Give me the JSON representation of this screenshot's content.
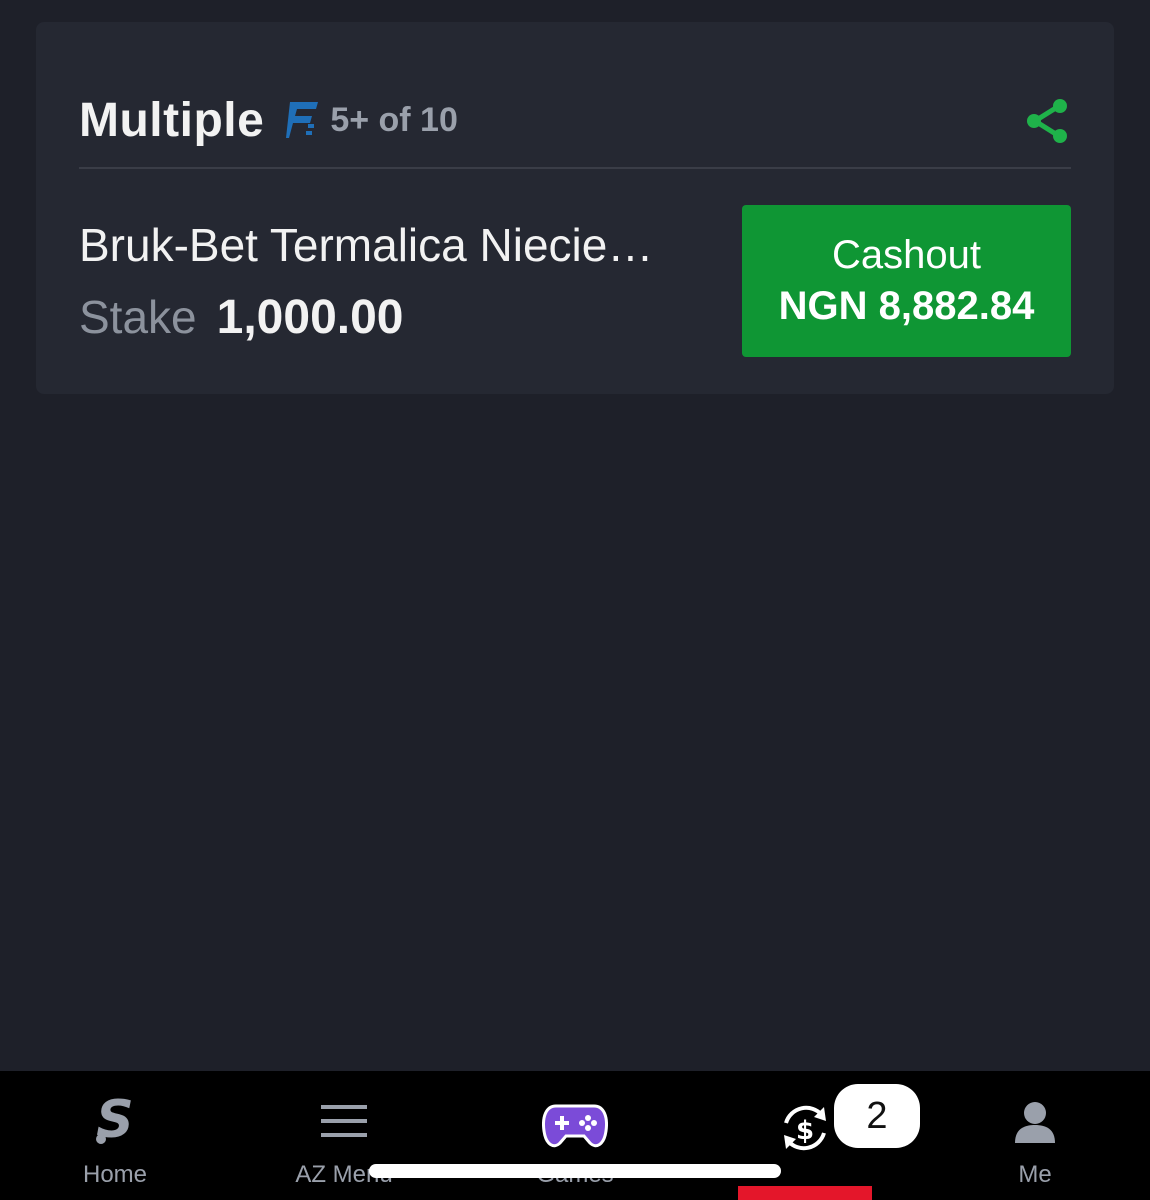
{
  "bet": {
    "type": "Multiple",
    "flex_label": "5+ of 10",
    "match": "Bruk-Bet Termalica Niecie…",
    "stake_label": "Stake",
    "stake_value": "1,000.00",
    "cashout_label": "Cashout",
    "cashout_amount": "NGN 8,882.84"
  },
  "nav": {
    "items": [
      {
        "label": "Home",
        "icon": "home-logo-icon"
      },
      {
        "label": "AZ Menu",
        "icon": "hamburger-menu-icon"
      },
      {
        "label": "Games",
        "icon": "gamepad-icon"
      },
      {
        "label": "",
        "icon": "cashout-icon",
        "badge": "2",
        "active": true
      },
      {
        "label": "Me",
        "icon": "user-icon"
      }
    ]
  },
  "colors": {
    "background": "#1e2029",
    "card": "#252832",
    "cashout_green": "#0f9634",
    "share_green": "#1fb24a",
    "games_purple": "#7b4bd8",
    "active_red": "#e4162a",
    "flex_blue": "#1f6fb8"
  }
}
